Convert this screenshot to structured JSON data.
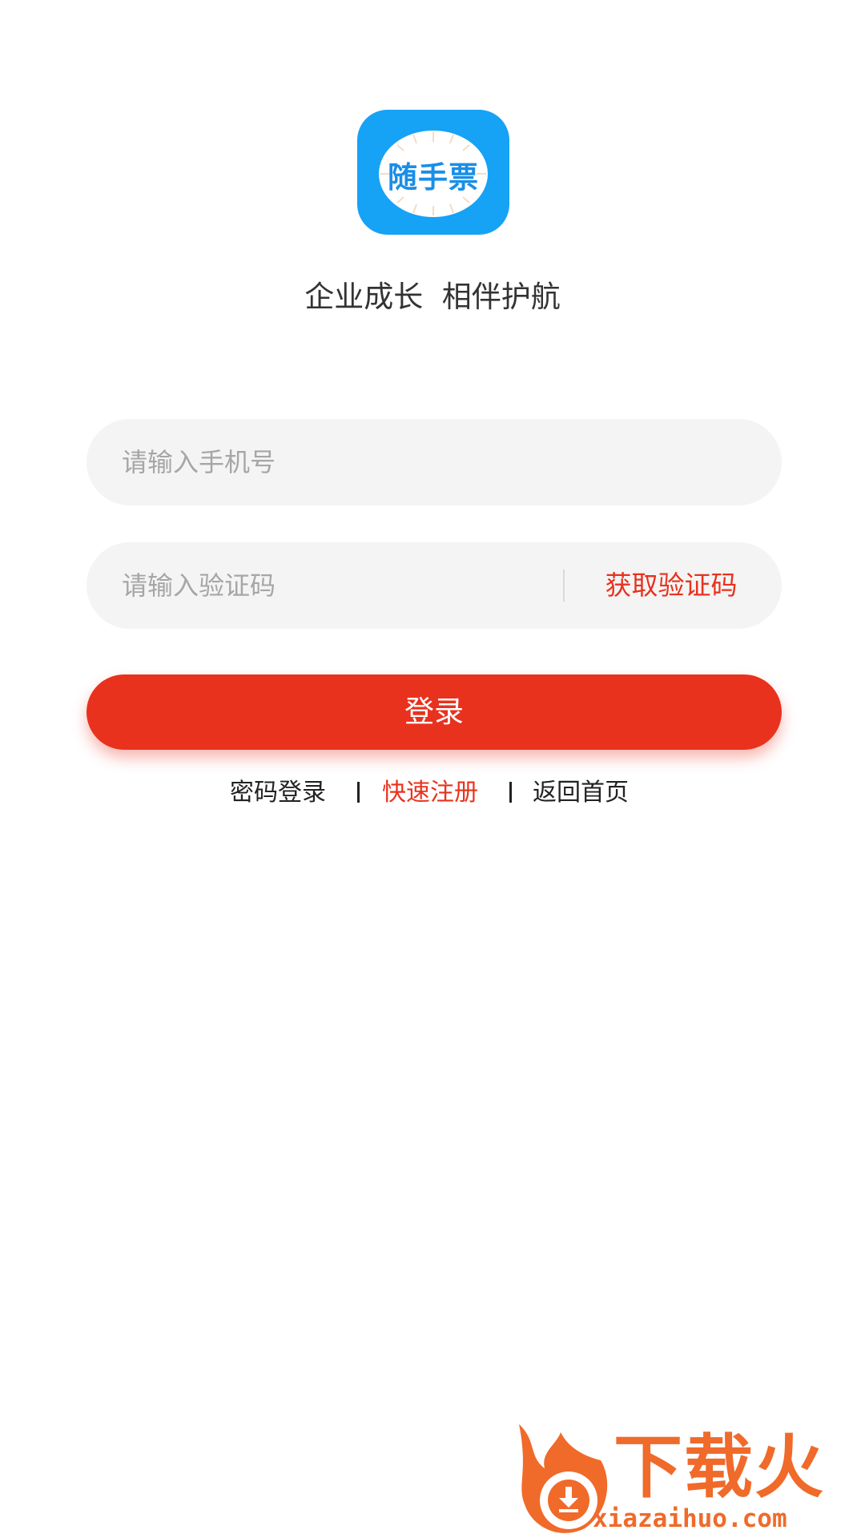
{
  "app": {
    "logo_text": "随手票",
    "slogan": "企业成长  相伴护航"
  },
  "form": {
    "phone_placeholder": "请输入手机号",
    "code_placeholder": "请输入验证码",
    "get_code_label": "获取验证码",
    "login_label": "登录"
  },
  "links": {
    "password_login": "密码登录",
    "quick_register": "快速注册",
    "back_home": "返回首页"
  },
  "watermark": {
    "brand": "下载火",
    "domain": "xiazaihuo.com"
  },
  "colors": {
    "accent": "#e8321e",
    "logo_background": "#16a2f5",
    "input_background": "#f4f4f4",
    "watermark": "#f06a2a"
  }
}
